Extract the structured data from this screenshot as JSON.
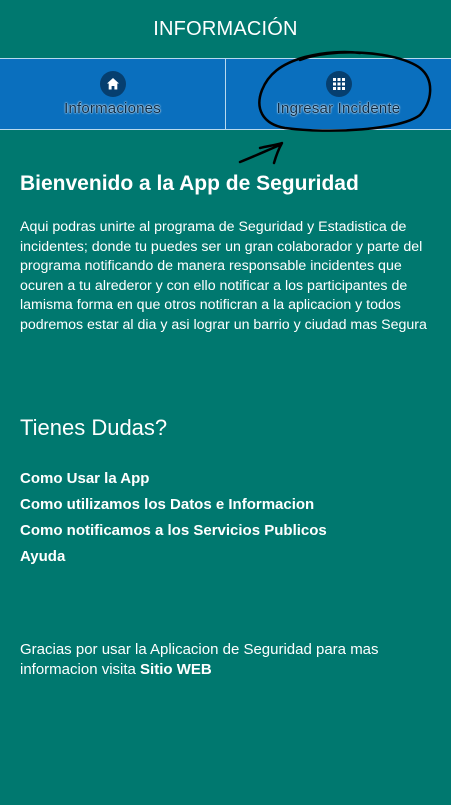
{
  "header": {
    "title": "INFORMACIÓN"
  },
  "tabs": [
    {
      "label": "Informaciones",
      "icon": "home-icon"
    },
    {
      "label": "Ingresar Incidente",
      "icon": "grid-icon"
    }
  ],
  "welcome": {
    "title": "Bienvenido a la App de Seguridad",
    "body": "Aqui podras unirte al programa de Seguridad y Estadistica de incidentes; donde tu puedes ser un gran colaborador y parte del programa notificando de manera responsable incidentes que ocuren a tu alrederor y con ello notificar a los participantes de lamisma forma en que otros notificran a la aplicacion y todos podremos estar al dia y asi lograr un barrio y ciudad mas Segura"
  },
  "doubts": {
    "title": "Tienes Dudas?",
    "links": [
      "Como Usar la App",
      "Como utilizamos los Datos e Informacion",
      "Como notificamos a los Servicios Publicos",
      "Ayuda"
    ]
  },
  "footer": {
    "text": "Gracias por usar la Aplicacion de Seguridad para mas informacion visita ",
    "link": "Sitio WEB"
  },
  "colors": {
    "background": "#00786f",
    "tabbar": "#0a6fbe",
    "icon_circle": "#063f6f",
    "annotation": "#000000"
  }
}
